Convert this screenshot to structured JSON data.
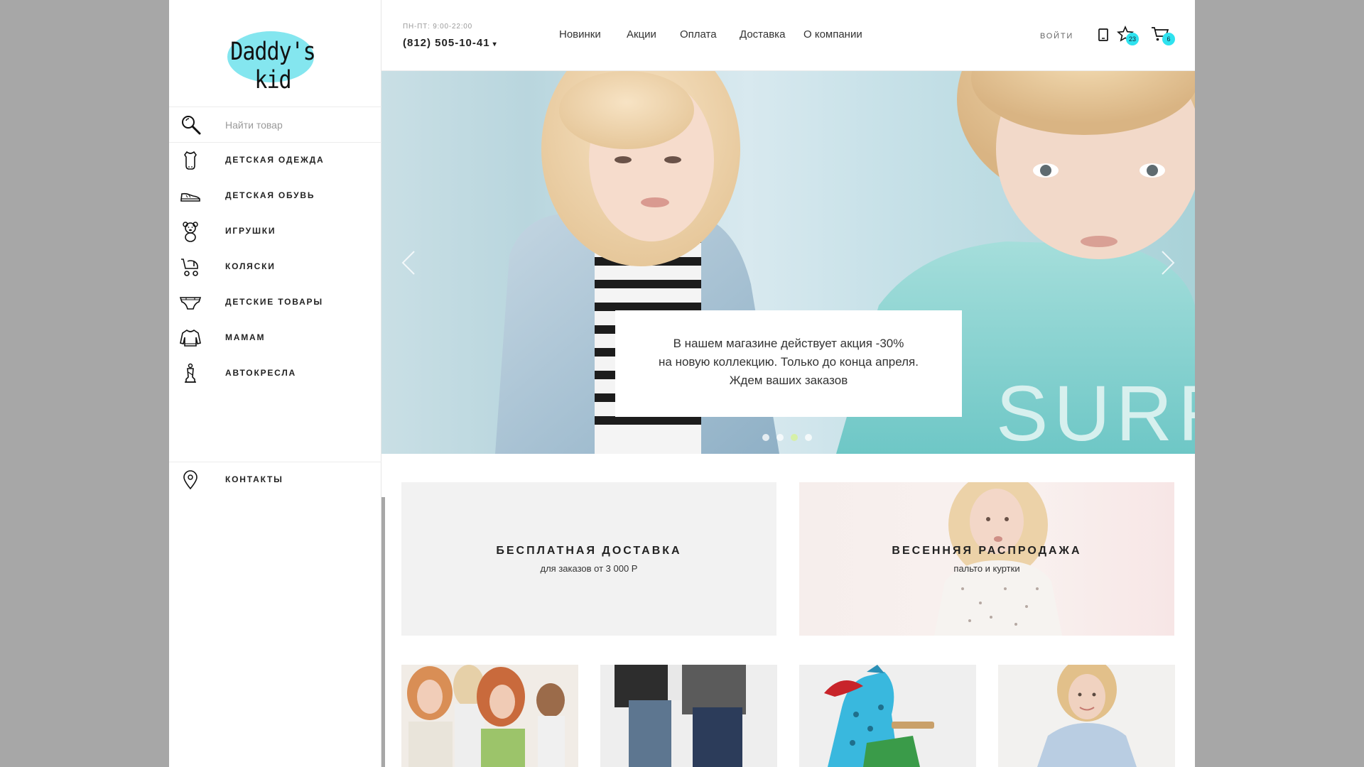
{
  "brand": {
    "logo_text": "Daddy's kid",
    "accent_color": "#84e6ef",
    "badge_color": "#2ee2ef"
  },
  "search": {
    "placeholder": "Найти товар",
    "icon": "search-icon"
  },
  "categories": [
    {
      "label": "ДЕТСКАЯ ОДЕЖДА",
      "icon": "bodysuit-icon"
    },
    {
      "label": "ДЕТСКАЯ ОБУВЬ",
      "icon": "shoe-icon"
    },
    {
      "label": "ИГРУШКИ",
      "icon": "teddy-bear-icon"
    },
    {
      "label": "КОЛЯСКИ",
      "icon": "stroller-icon"
    },
    {
      "label": "ДЕТСКИЕ ТОВАРЫ",
      "icon": "diaper-icon"
    },
    {
      "label": "МАМАМ",
      "icon": "sweater-icon"
    },
    {
      "label": "АВТОКРЕСЛА",
      "icon": "car-seat-icon"
    }
  ],
  "contacts": {
    "label": "КОНТАКТЫ",
    "icon": "location-pin-icon"
  },
  "header": {
    "hours": "ПН-ПТ: 9:00-22:00",
    "phone": "(812) 505-10-41",
    "nav": [
      "Новинки",
      "Акции",
      "Оплата",
      "Доставка",
      "О компании"
    ],
    "login": "ВОЙТИ",
    "favorites_count": "23",
    "cart_count": "6"
  },
  "hero": {
    "promo_lines": [
      "В нашем магазине действует акция -30%",
      "на новую коллекцию. Только до конца апреля.",
      "Ждем ваших заказов"
    ],
    "slide_count": 4,
    "active_slide": 3,
    "shirt_text": "SURF"
  },
  "banners": [
    {
      "title": "БЕСПЛАТНАЯ ДОСТАВКА",
      "subtitle": "для заказов от 3 000 Р"
    },
    {
      "title": "ВЕСЕННЯЯ РАСПРОДАЖА",
      "subtitle": "пальто и куртки"
    }
  ]
}
